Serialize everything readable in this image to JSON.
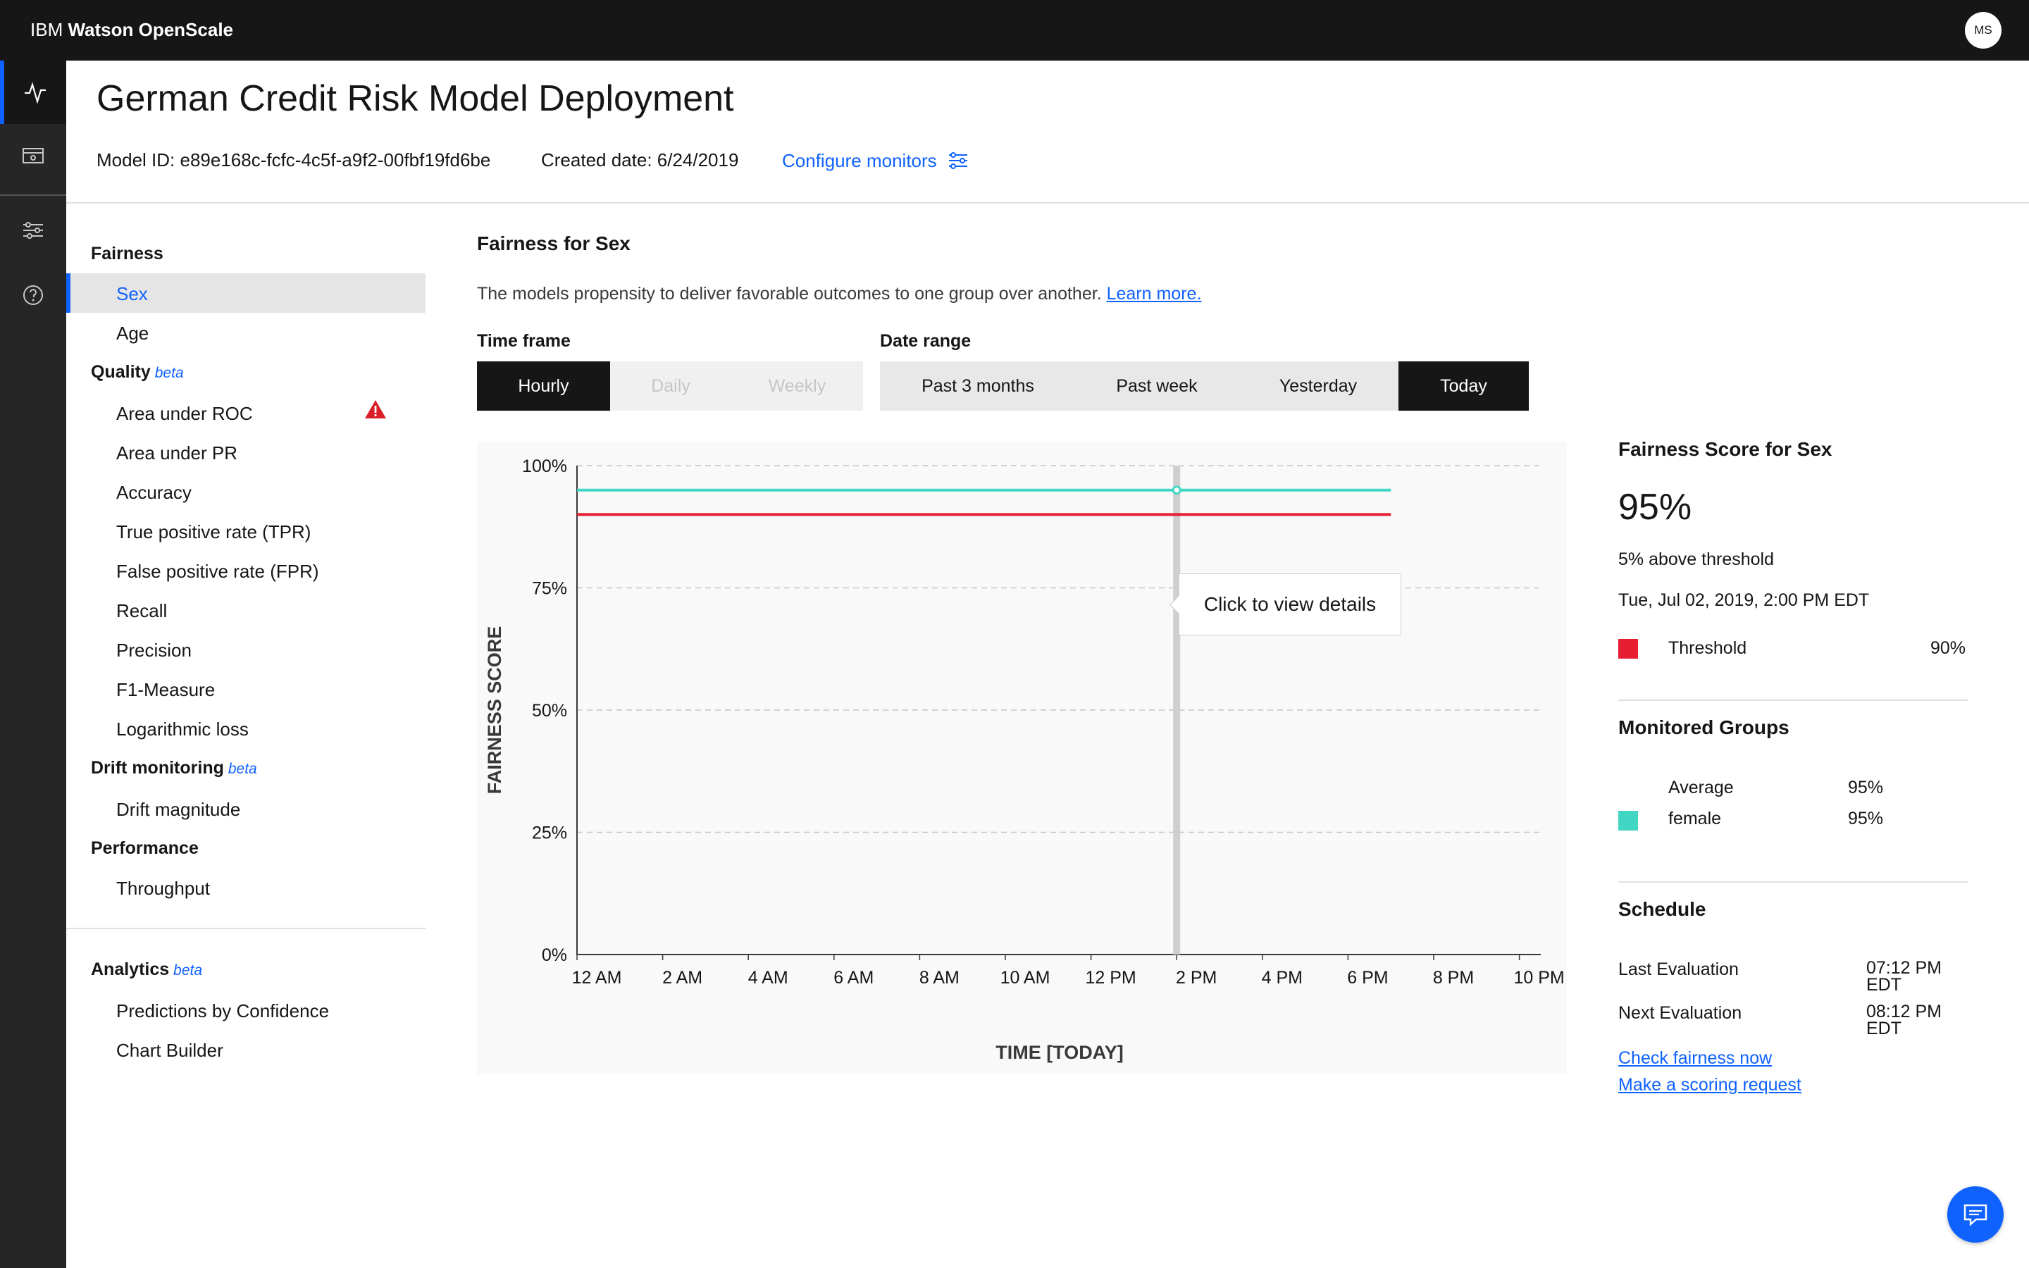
{
  "app": {
    "brand_prefix": "IBM",
    "brand_name": "Watson OpenScale",
    "user_initials": "MS"
  },
  "rail": {
    "icons": [
      "activity-icon",
      "deployment-icon",
      "settings-sliders-icon",
      "help-icon"
    ]
  },
  "header": {
    "title": "German Credit Risk Model Deployment",
    "model_id": "Model ID: e89e168c-fcfc-4c5f-a9f2-00fbf19fd6be",
    "created": "Created date: 6/24/2019",
    "configure_label": "Configure monitors"
  },
  "nav": {
    "fairness": {
      "label": "Fairness",
      "items": [
        "Sex",
        "Age"
      ]
    },
    "quality": {
      "label": "Quality",
      "badge": "beta",
      "items": [
        "Area under ROC",
        "Area under PR",
        "Accuracy",
        "True positive rate (TPR)",
        "False positive rate (FPR)",
        "Recall",
        "Precision",
        "F1-Measure",
        "Logarithmic loss"
      ]
    },
    "drift": {
      "label": "Drift monitoring",
      "badge": "beta",
      "items": [
        "Drift magnitude"
      ]
    },
    "performance": {
      "label": "Performance",
      "items": [
        "Throughput"
      ]
    },
    "analytics": {
      "label": "Analytics",
      "badge": "beta",
      "items": [
        "Predictions by Confidence",
        "Chart Builder"
      ]
    }
  },
  "main": {
    "title": "Fairness for Sex",
    "description": "The models propensity to deliver favorable outcomes to one group over another.",
    "learn_more": "Learn more.",
    "timeframe": {
      "label": "Time frame",
      "options": [
        "Hourly",
        "Daily",
        "Weekly"
      ],
      "selected": "Hourly"
    },
    "daterange": {
      "label": "Date range",
      "options": [
        "Past 3 months",
        "Past week",
        "Yesterday",
        "Today"
      ],
      "selected": "Today"
    },
    "tooltip": "Click to view details"
  },
  "chart_data": {
    "type": "line",
    "xlabel": "TIME [TODAY]",
    "ylabel": "FAIRNESS SCORE",
    "x_ticks": [
      "12 AM",
      "2 AM",
      "4 AM",
      "6 AM",
      "8 AM",
      "10 AM",
      "12 PM",
      "2 PM",
      "4 PM",
      "6 PM",
      "8 PM",
      "10 PM"
    ],
    "y_ticks": [
      "0%",
      "25%",
      "50%",
      "75%",
      "100%"
    ],
    "ylim": [
      0,
      100
    ],
    "xlim_hours": [
      0,
      22.5
    ],
    "grid": true,
    "series": [
      {
        "name": "female",
        "color": "#41d6c3",
        "x_hours": [
          0,
          19
        ],
        "values": [
          95,
          95
        ]
      },
      {
        "name": "Threshold",
        "color": "#e71d32",
        "x_hours": [
          0,
          19
        ],
        "values": [
          90,
          90
        ]
      }
    ],
    "selected_x_hours": 14,
    "selected_value": 95
  },
  "score": {
    "title": "Fairness Score for Sex",
    "value": "95%",
    "above": "5% above threshold",
    "timestamp": "Tue, Jul 02, 2019, 2:00 PM EDT",
    "threshold_label": "Threshold",
    "threshold_value": "90%",
    "threshold_color": "#e71d32"
  },
  "groups": {
    "title": "Monitored Groups",
    "rows": [
      {
        "label": "Average",
        "value": "95%"
      },
      {
        "label": "female",
        "value": "95%",
        "color": "#41d6c3"
      }
    ]
  },
  "schedule": {
    "title": "Schedule",
    "last_label": "Last Evaluation",
    "last_time": "07:12 PM",
    "last_tz": "EDT",
    "next_label": "Next Evaluation",
    "next_time": "08:12 PM",
    "next_tz": "EDT",
    "check_link": "Check fairness now",
    "scoring_link": "Make a scoring request"
  }
}
